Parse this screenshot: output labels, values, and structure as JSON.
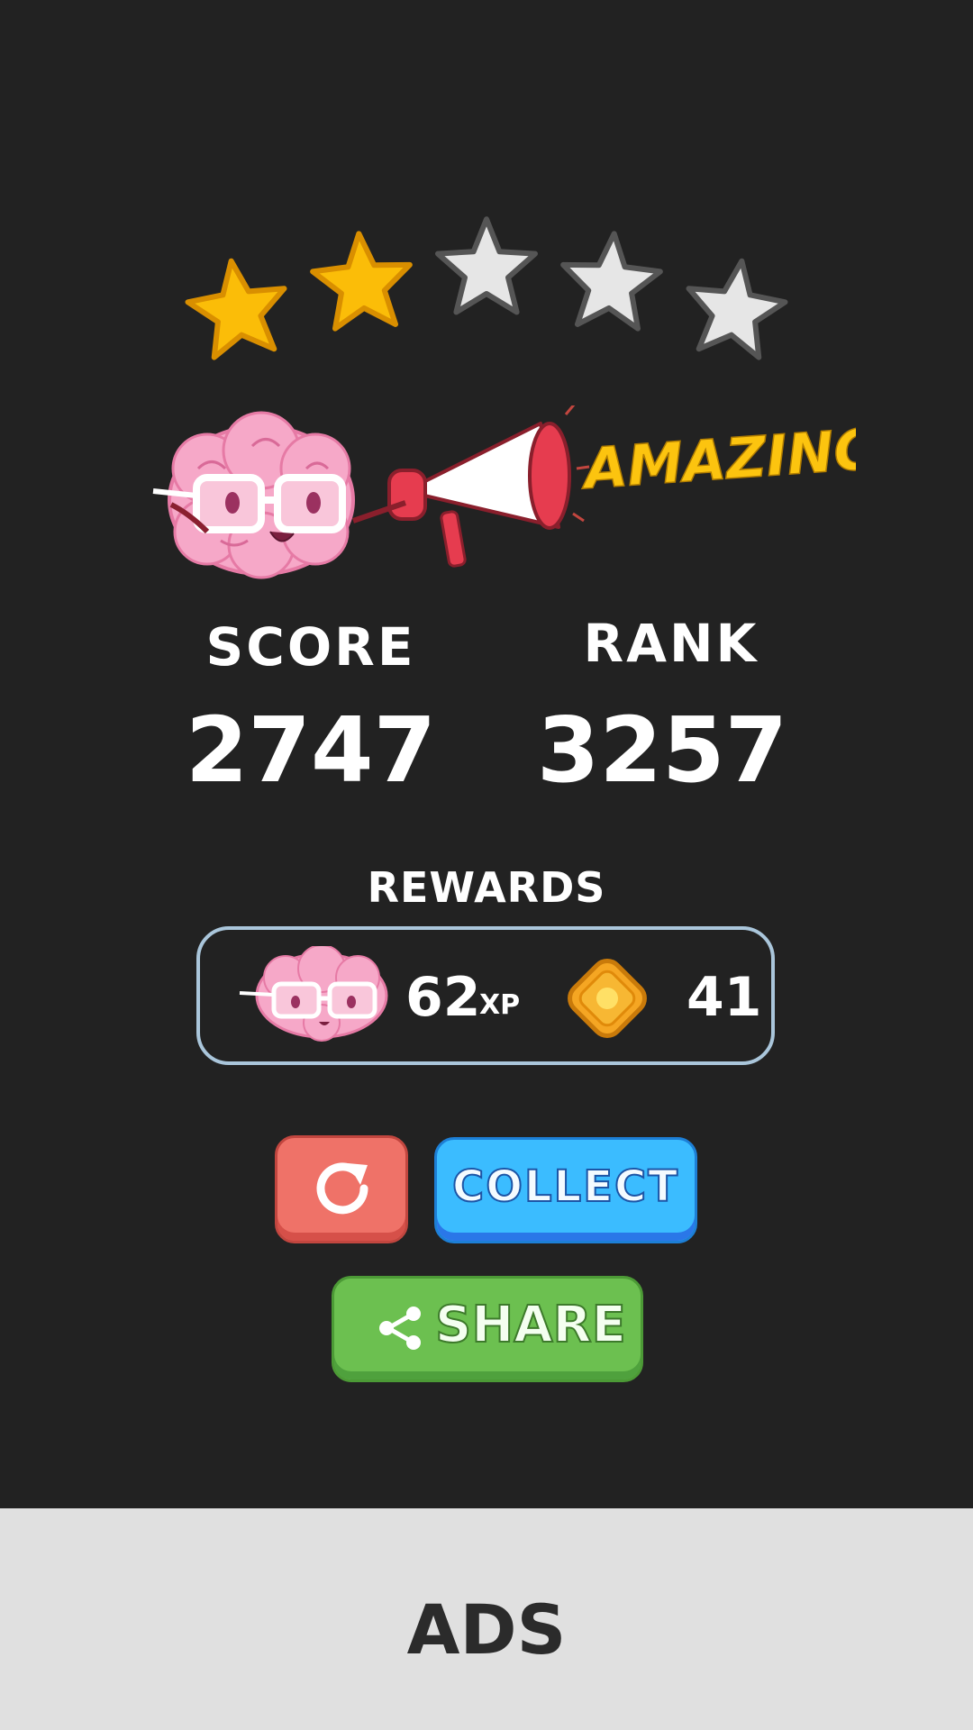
{
  "rating": {
    "stars_earned": 2,
    "stars_total": 5,
    "filled_color": "#fbbd08",
    "empty_color": "#e6e6e6"
  },
  "banner": {
    "text": "AMAZING!",
    "color": "#fcc40f"
  },
  "score": {
    "label": "SCORE",
    "value": "2747"
  },
  "rank": {
    "label": "RANK",
    "value": "3257"
  },
  "rewards": {
    "title": "REWARDS",
    "xp_value": "62",
    "xp_unit": "XP",
    "coin_value": "41",
    "xp_icon": "brain-mascot-icon",
    "coin_icon": "coin-icon"
  },
  "buttons": {
    "replay_icon": "replay-icon",
    "collect_label": "COLLECT",
    "share_label": "SHARE",
    "share_icon": "share-icon"
  },
  "ads": {
    "label": "ADS"
  }
}
